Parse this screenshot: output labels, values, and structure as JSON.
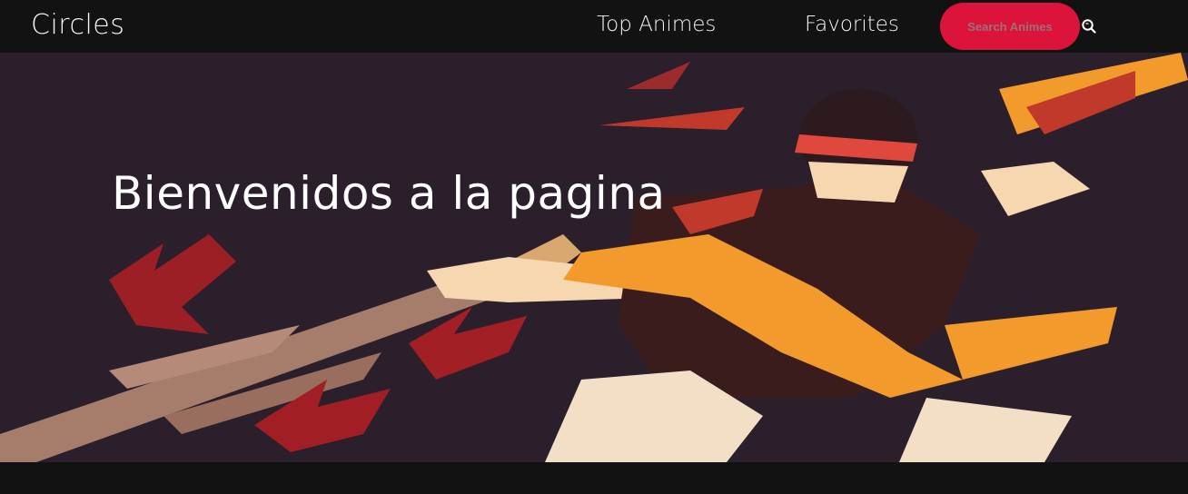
{
  "navbar": {
    "brand": "Circles",
    "links": [
      {
        "label": "Top Animes"
      },
      {
        "label": "Favorites"
      }
    ],
    "search": {
      "placeholder": "Search Animes",
      "icon": "search-icon"
    }
  },
  "hero": {
    "title": "Bienvenidos a la pagina"
  },
  "colors": {
    "navbar_bg": "#121212",
    "search_accent": "#dc143c",
    "hero_bg": "#2a1f2a"
  }
}
